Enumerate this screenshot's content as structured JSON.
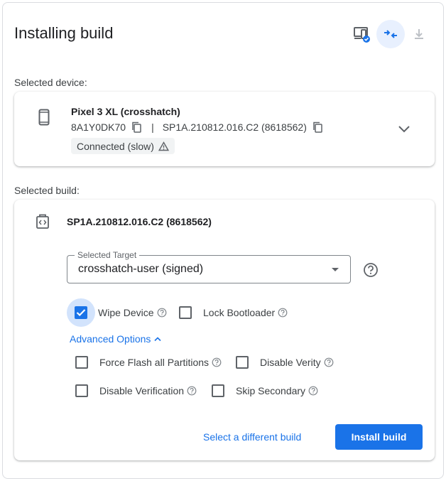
{
  "header": {
    "title": "Installing build",
    "icons": [
      "device-check-icon",
      "collapse-arrows-icon",
      "download-icon"
    ]
  },
  "device_section": {
    "label": "Selected device:",
    "name": "Pixel 3 XL (crosshatch)",
    "serial": "8A1Y0DK70",
    "separator": "|",
    "build": "SP1A.210812.016.C2 (8618562)",
    "status": "Connected (slow)"
  },
  "build_section": {
    "label": "Selected build:",
    "build_id": "SP1A.210812.016.C2 (8618562)",
    "target": {
      "legend": "Selected Target",
      "value": "crosshatch-user (signed)"
    },
    "options": {
      "wipe_device": {
        "label": "Wipe Device",
        "checked": true
      },
      "lock_bootloader": {
        "label": "Lock Bootloader",
        "checked": false
      }
    },
    "advanced_toggle": "Advanced Options",
    "advanced": {
      "force_flash": {
        "label": "Force Flash all Partitions",
        "checked": false
      },
      "disable_verity": {
        "label": "Disable Verity",
        "checked": false
      },
      "disable_verification": {
        "label": "Disable Verification",
        "checked": false
      },
      "skip_secondary": {
        "label": "Skip Secondary",
        "checked": false
      }
    },
    "actions": {
      "select_different": "Select a different build",
      "install": "Install build"
    }
  },
  "colors": {
    "accent": "#1a73e8",
    "accent_light": "#e8f0fe"
  }
}
